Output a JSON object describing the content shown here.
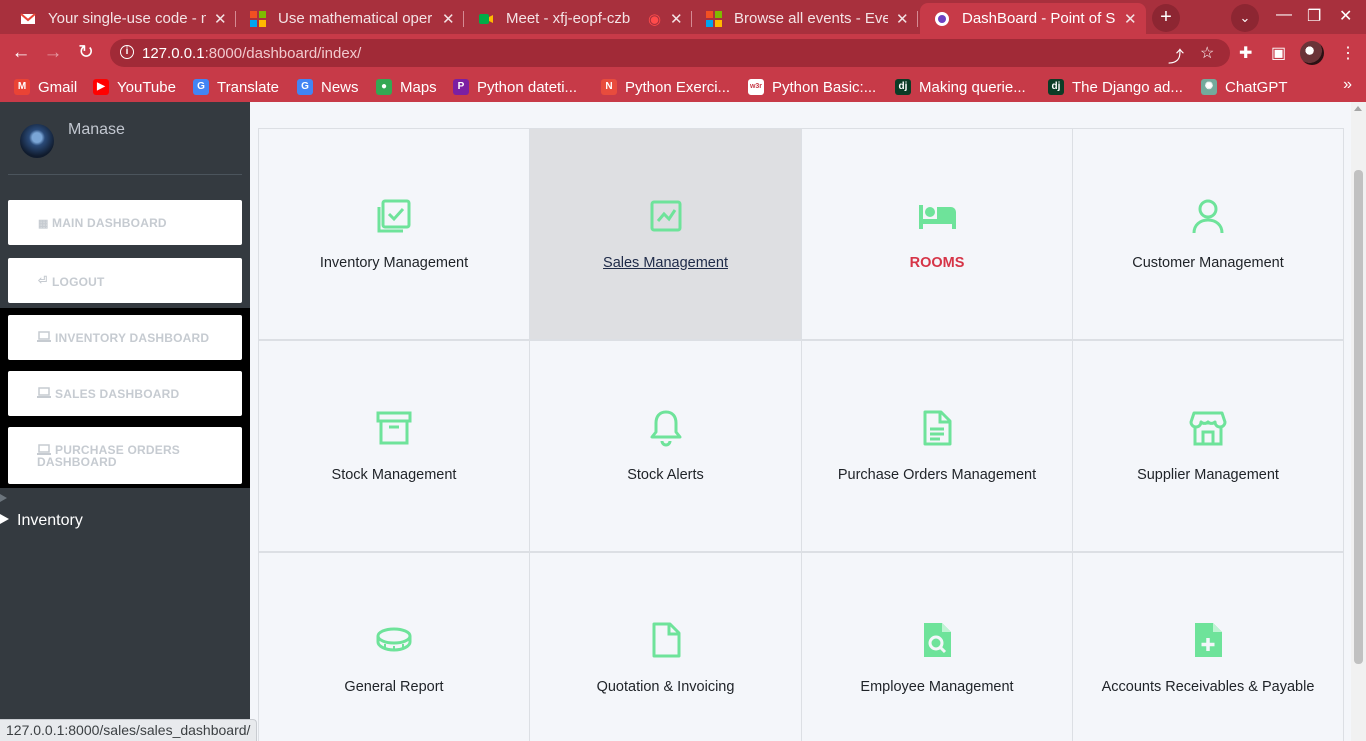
{
  "browser": {
    "tabs": [
      {
        "title": "Your single-use code - m",
        "favicon": "gmail-icon",
        "color": "#ea4335"
      },
      {
        "title": "Use mathematical oper",
        "favicon": "microsoft-icon",
        "color": "#f25022"
      },
      {
        "title": "Meet - xfj-eopf-czb",
        "favicon": "meet-icon",
        "color": "#00ac47"
      },
      {
        "title": "Browse all events - Even",
        "favicon": "microsoft-icon",
        "color": "#f25022"
      },
      {
        "title": "DashBoard - Point of Sal",
        "favicon": "app-icon",
        "color": "#6f42c1"
      }
    ],
    "url_host": "127.0.0.1",
    "url_path": ":8000/dashboard/index/",
    "bookmarks": [
      {
        "label": "Gmail",
        "icon": "gmail-icon",
        "color": "#ea4335",
        "glyph": "M"
      },
      {
        "label": "YouTube",
        "icon": "youtube-icon",
        "color": "#ff0000",
        "glyph": "▶"
      },
      {
        "label": "Translate",
        "icon": "translate-icon",
        "color": "#4285f4",
        "glyph": "G"
      },
      {
        "label": "News",
        "icon": "news-icon",
        "color": "#4285f4",
        "glyph": "G"
      },
      {
        "label": "Maps",
        "icon": "maps-icon",
        "color": "#34a853",
        "glyph": "●"
      },
      {
        "label": "Python dateti...",
        "icon": "python-icon",
        "color": "#7b1fa2",
        "glyph": "P"
      },
      {
        "label": "Python Exerci...",
        "icon": "w3resource-icon",
        "color": "#e84c3d",
        "glyph": "N"
      },
      {
        "label": "Python Basic:...",
        "icon": "w3r-icon",
        "color": "#ffffff",
        "glyph": "w3r"
      },
      {
        "label": "Making querie...",
        "icon": "django-icon",
        "color": "#0c3c26",
        "glyph": "dj"
      },
      {
        "label": "The Django ad...",
        "icon": "django-icon",
        "color": "#0c3c26",
        "glyph": "dj"
      },
      {
        "label": "ChatGPT",
        "icon": "chatgpt-icon",
        "color": "#74aa9c",
        "glyph": "✺"
      }
    ]
  },
  "sidebar": {
    "user_name": "Manase",
    "buttons": [
      {
        "label": "MAIN DASHBOARD",
        "icon": "grid-icon",
        "glyph": "▦"
      },
      {
        "label": "LOGOUT",
        "icon": "logout-icon",
        "glyph": "⏎"
      },
      {
        "label": "INVENTORY DASHBOARD",
        "icon": "laptop-icon",
        "glyph": "💻"
      },
      {
        "label": "SALES DASHBOARD",
        "icon": "laptop-icon",
        "glyph": "💻"
      },
      {
        "label": "PURCHASE ORDERS DASHBOARD",
        "icon": "laptop-icon",
        "glyph": "💻"
      }
    ],
    "tree_item": "Inventory"
  },
  "modules": [
    {
      "label": "Inventory Management",
      "icon": "checklist-icon"
    },
    {
      "label": "Sales Management",
      "icon": "chart-icon"
    },
    {
      "label": "ROOMS",
      "icon": "bed-icon"
    },
    {
      "label": "Customer Management",
      "icon": "user-icon"
    },
    {
      "label": "Stock Management",
      "icon": "archive-icon"
    },
    {
      "label": "Stock Alerts",
      "icon": "bell-icon"
    },
    {
      "label": "Purchase Orders Management",
      "icon": "document-icon"
    },
    {
      "label": "Supplier Management",
      "icon": "store-icon"
    },
    {
      "label": "General Report",
      "icon": "coin-icon"
    },
    {
      "label": "Quotation & Invoicing",
      "icon": "file-icon"
    },
    {
      "label": "Employee Management",
      "icon": "file-search-icon"
    },
    {
      "label": "Accounts Receivables & Payable",
      "icon": "file-plus-icon"
    }
  ],
  "colors": {
    "accent": "#6ee39a",
    "rooms_label": "#d63447",
    "chrome": "#c73a48"
  },
  "status_url": "127.0.0.1:8000/sales/sales_dashboard/"
}
